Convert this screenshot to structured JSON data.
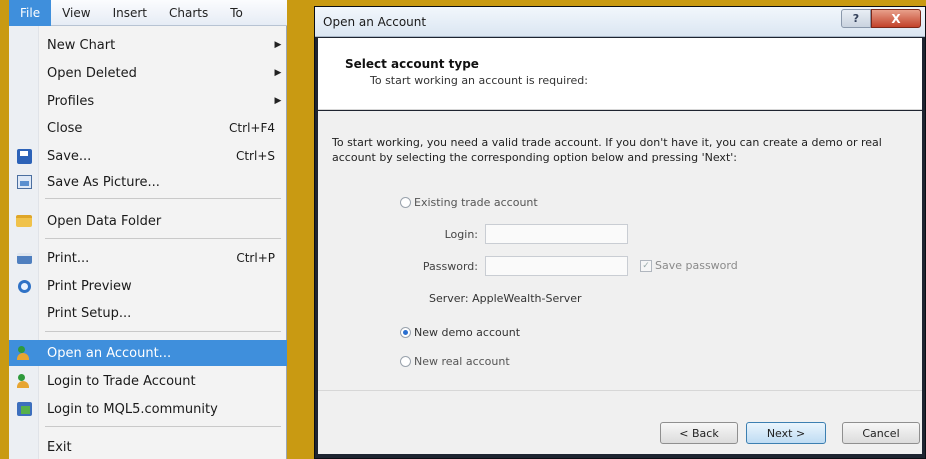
{
  "menubar": {
    "items": [
      {
        "label": "File",
        "active": true
      },
      {
        "label": "View"
      },
      {
        "label": "Insert"
      },
      {
        "label": "Charts"
      },
      {
        "label": "To"
      }
    ]
  },
  "file_menu": {
    "items": [
      {
        "label": "New Chart",
        "submenu": true
      },
      {
        "label": "Open Deleted",
        "submenu": true
      },
      {
        "label": "Profiles",
        "submenu": true
      },
      {
        "label": "Close",
        "shortcut": "Ctrl+F4"
      },
      {
        "label": "Save...",
        "shortcut": "Ctrl+S",
        "icon": "save-icon"
      },
      {
        "label": "Save As Picture...",
        "icon": "picture-icon"
      },
      {
        "label": "Open Data Folder",
        "icon": "folder-icon"
      },
      {
        "label": "Print...",
        "shortcut": "Ctrl+P",
        "icon": "printer-icon"
      },
      {
        "label": "Print Preview",
        "icon": "print-preview-icon"
      },
      {
        "label": "Print Setup..."
      },
      {
        "label": "Open an Account...",
        "icon": "account-icon",
        "highlighted": true
      },
      {
        "label": "Login to Trade Account",
        "icon": "login-icon"
      },
      {
        "label": "Login to MQL5.community",
        "icon": "mql5-icon"
      },
      {
        "label": "Exit"
      }
    ],
    "highlight_color": "#3f8fdc"
  },
  "dialog": {
    "title": "Open an Account",
    "help_label": "?",
    "close_label": "X",
    "header_title": "Select account type",
    "header_subtitle": "To start working an account is required:",
    "intro": "To start working, you need a valid trade account. If you don't have it, you can create a demo or real account by selecting the corresponding option below and pressing 'Next':",
    "options": {
      "existing": "Existing trade account",
      "demo": "New demo account",
      "real": "New real account",
      "selected": "demo"
    },
    "login_label": "Login:",
    "login_value": "",
    "password_label": "Password:",
    "password_value": "",
    "save_password_label": "Save password",
    "server_label": "Server:",
    "server_value": "AppleWealth-Server",
    "buttons": {
      "back": "< Back",
      "next": "Next >",
      "cancel": "Cancel"
    }
  }
}
